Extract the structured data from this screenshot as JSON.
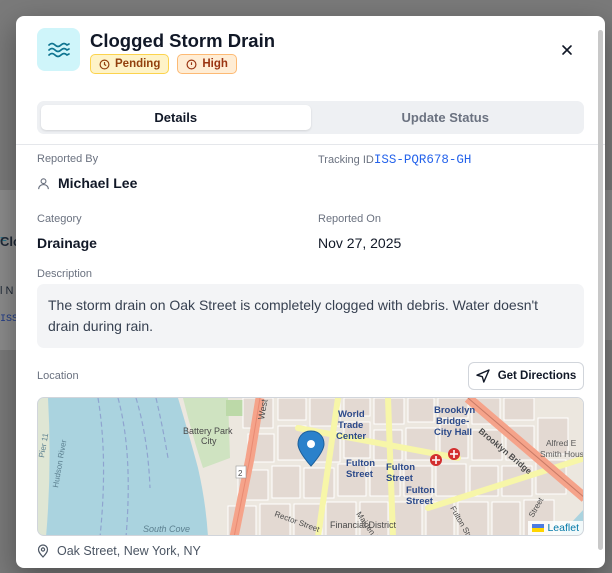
{
  "issue": {
    "title": "Clogged Storm Drain",
    "icon": "water-waves-icon",
    "status_badge": "Pending",
    "priority_badge": "High"
  },
  "tabs": [
    {
      "label": "Details",
      "active": true
    },
    {
      "label": "Update Status",
      "active": false
    }
  ],
  "details": {
    "reported_by_label": "Reported By",
    "reported_by_value": "Michael Lee",
    "tracking_label": "Tracking ID",
    "tracking_value": "ISS-PQR678-GH",
    "category_label": "Category",
    "category_value": "Drainage",
    "reported_on_label": "Reported On",
    "reported_on_value": "Nov 27, 2025",
    "description_label": "Description",
    "description_value": "The storm drain on Oak Street is completely clogged with debris. Water doesn't drain during rain.",
    "location_label": "Location",
    "directions_label": "Get Directions",
    "address": "Oak Street, New York, NY"
  },
  "map": {
    "attribution": "Leaflet",
    "labels": {
      "battery_park_1": "Battery Park",
      "battery_park_2": "City",
      "world_trade_1": "World",
      "world_trade_2": "Trade",
      "world_trade_3": "Center",
      "fulton_1a": "Fulton",
      "fulton_1b": "Street",
      "fulton_2a": "Fulton",
      "fulton_2b": "Street",
      "fulton_3a": "Fulton",
      "fulton_3b": "Street",
      "brooklyn_city_1": "Brooklyn",
      "brooklyn_city_2": "Bridge-",
      "brooklyn_city_3": "City Hall",
      "brooklyn_bridge": "Brooklyn Bridge",
      "alfred_1": "Alfred E",
      "alfred_2": "Smith Houses",
      "financial_district": "Financial District",
      "south_cove": "South Cove",
      "west_st": "West",
      "rector_st": "Rector Street",
      "maiden_lane": "Maiden Lane",
      "fulton_st_diag": "Fulton Street",
      "street_top": "Street",
      "route_2": "2",
      "pier": "Pier 11",
      "hudson": "Hudson River"
    }
  },
  "background": {
    "heading_fragment": "Clo",
    "sub_fragment": "l N",
    "id_fragment": "ISS"
  },
  "colors": {
    "accent_blue": "#2563eb",
    "icon_bg": "#cff5fa",
    "icon_fg": "#0e7490",
    "pending_bg": "#fef3c7",
    "high_bg": "#ffedd5",
    "water": "#aad3df",
    "land": "#f2efe9"
  }
}
